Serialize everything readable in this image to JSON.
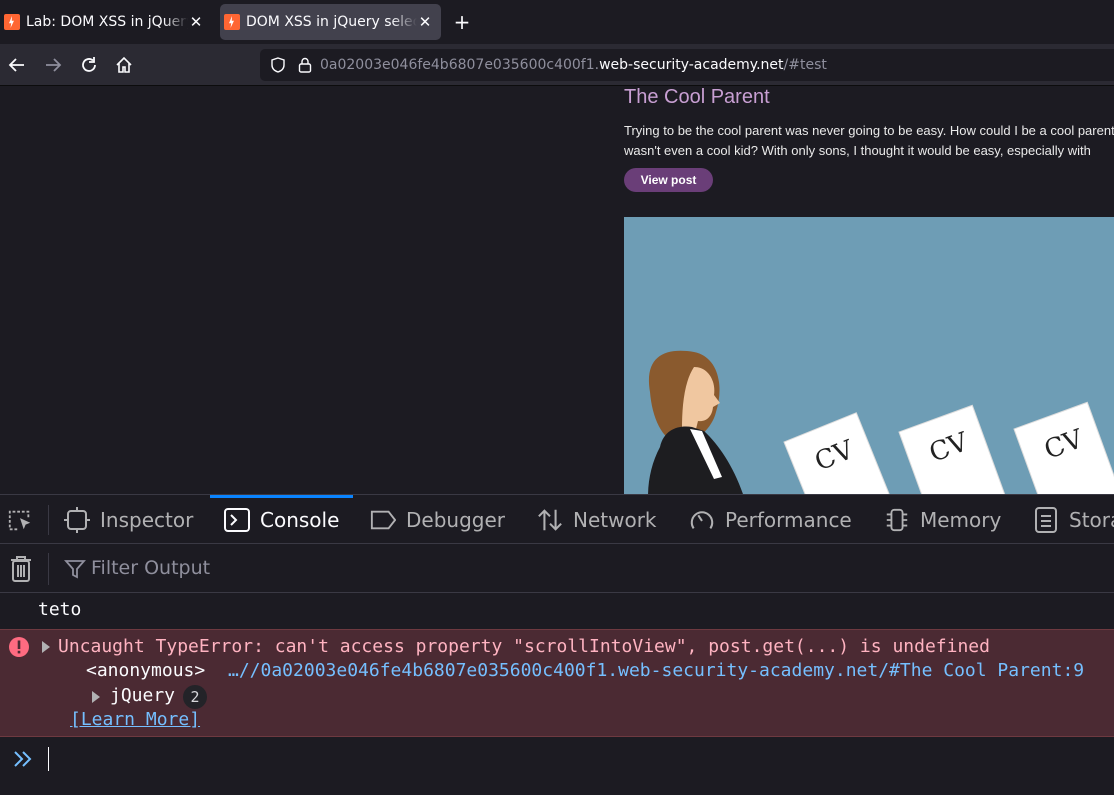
{
  "tabs": [
    {
      "title": "Lab: DOM XSS in jQuery selector sink using a hashchange event",
      "active": false
    },
    {
      "title": "DOM XSS in jQuery selector sink using a hashchange event",
      "active": true
    }
  ],
  "address_bar": {
    "url_prefix": "0a02003e046fe4b6807e035600c400f1.",
    "url_host": "web-security-academy.net",
    "url_suffix": "/#test"
  },
  "page": {
    "post_title": "The Cool Parent",
    "post_line1": "Trying to be the cool parent was never going to be easy. How could I be a cool parent when I",
    "post_line2": "wasn't even a cool kid? With only sons, I thought it would be easy, especially with",
    "view_post_label": "View post",
    "cv_label": "CV"
  },
  "devtools": {
    "tabs": [
      "Inspector",
      "Console",
      "Debugger",
      "Network",
      "Performance",
      "Memory",
      "Storage"
    ],
    "selected_tab": "Console",
    "filter_placeholder": "Filter Output",
    "console": {
      "log_message": "teto",
      "error_message": "Uncaught TypeError: can't access property \"scrollIntoView\", post.get(...) is undefined",
      "stack_fn": "<anonymous>",
      "stack_location": "…//0a02003e046fe4b6807e035600c400f1.web-security-academy.net/#The Cool Parent:9",
      "stack_group": "jQuery",
      "stack_group_count": "2",
      "learn_more": "[Learn More]"
    }
  },
  "colors": {
    "accent": "#0a84ff",
    "error_bg": "#4b2a33",
    "link": "#75bfff",
    "post_title": "#c89fd3",
    "button_purple": "#6a3e78"
  }
}
